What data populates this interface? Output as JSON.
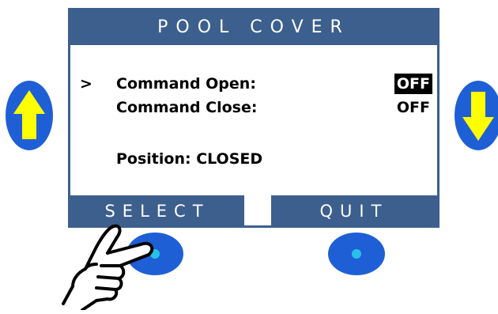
{
  "screen": {
    "title": "POOL COVER",
    "rows": [
      {
        "cursor": ">",
        "label": "Command Open:",
        "value": "OFF",
        "highlighted": true
      },
      {
        "cursor": "",
        "label": "Command Close:",
        "value": "OFF",
        "highlighted": false
      }
    ],
    "position_text": "Position: CLOSED"
  },
  "softkeys": {
    "left": "SELECT",
    "right": "QUIT"
  },
  "colors": {
    "panel_blue": "#3c5f8e",
    "arrow_yellow": "#ffff00",
    "button_blue": "#1f5fd6",
    "button_dot": "#27c1e8"
  },
  "icons": {
    "up_button": "up-arrow-icon",
    "down_button": "down-arrow-icon",
    "pointer": "pointing-hand-icon"
  }
}
